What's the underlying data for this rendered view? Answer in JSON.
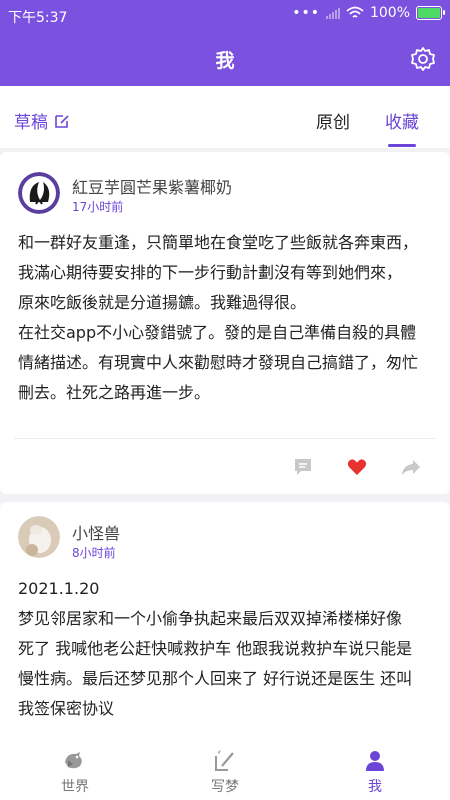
{
  "status_bar": {
    "time": "下午5:37",
    "battery": "100%",
    "battery_level": 1.0
  },
  "header": {
    "title": "我"
  },
  "tabs": {
    "draft_label": "草稿",
    "items": [
      {
        "label": "原创"
      },
      {
        "label": "收藏"
      }
    ],
    "active": "收藏"
  },
  "posts": [
    {
      "user": "紅豆芋圓芒果紫薯椰奶",
      "time": "17小时前",
      "lines": [
        "和一群好友重逢，只簡單地在食堂吃了些飯就各奔東西，",
        "我滿心期待要安排的下一步行動計劃沒有等到她們來，",
        "原來吃飯後就是分道揚鑣。我難過得很。",
        "在社交app不小心發錯號了。發的是自己準備自殺的具體",
        "情緒描述。有現實中人來勸慰時才發現自己搞錯了，匆忙",
        "刪去。社死之路再進一步。"
      ],
      "liked": true
    },
    {
      "user": "小怪兽",
      "time": "8小时前",
      "lines": [
        "2021.1.20",
        "梦见邻居家和一个小偷争执起来最后双双掉浠楼梯好像",
        "死了 我喊他老公赶快喊救护车 他跟我说救护车说只能是",
        "慢性病。最后还梦见那个人回来了 好行说还是医生 还叫",
        "我签保密协议"
      ]
    }
  ],
  "bottom_nav": [
    {
      "label": "世界"
    },
    {
      "label": "写梦"
    },
    {
      "label": "我"
    }
  ],
  "colors": {
    "accent": "#7b52e0",
    "like": "#e8322f"
  }
}
